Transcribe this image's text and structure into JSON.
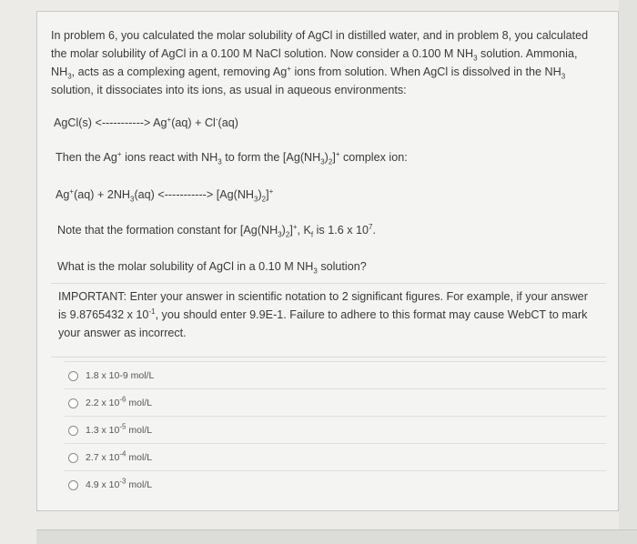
{
  "intro": [
    {
      "t": "In problem 6, you calculated the molar solubility of AgCl in distilled water, and in problem 8, you calculated the molar solubility of AgCl in a 0.100 M NaCl solution.  Now consider a 0.100 M NH"
    },
    {
      "t": "3",
      "k": "sub"
    },
    {
      "t": " solution. Ammonia, NH"
    },
    {
      "t": "3",
      "k": "sub"
    },
    {
      "t": ", acts as a complexing agent, removing Ag"
    },
    {
      "t": "+",
      "k": "sup"
    },
    {
      "t": " ions from solution. When AgCl is dissolved in the NH"
    },
    {
      "t": "3",
      "k": "sub"
    },
    {
      "t": " solution, it dissociates into its ions, as usual in aqueous environments:"
    }
  ],
  "eq1": [
    {
      "t": "AgCl(s)  <----------->  Ag"
    },
    {
      "t": "+",
      "k": "sup"
    },
    {
      "t": "(aq)  +  Cl"
    },
    {
      "t": "-",
      "k": "sup"
    },
    {
      "t": "(aq)"
    }
  ],
  "then": [
    {
      "t": "Then the Ag"
    },
    {
      "t": "+",
      "k": "sup"
    },
    {
      "t": " ions react with NH"
    },
    {
      "t": "3",
      "k": "sub"
    },
    {
      "t": " to form the [Ag(NH"
    },
    {
      "t": "3",
      "k": "sub"
    },
    {
      "t": ")"
    },
    {
      "t": "2",
      "k": "sub"
    },
    {
      "t": "]"
    },
    {
      "t": "+",
      "k": "sup"
    },
    {
      "t": " complex ion:"
    }
  ],
  "eq2": [
    {
      "t": "Ag"
    },
    {
      "t": "+",
      "k": "sup"
    },
    {
      "t": "(aq)  +  2NH"
    },
    {
      "t": "3",
      "k": "sub"
    },
    {
      "t": "(aq)  <----------->  [Ag(NH"
    },
    {
      "t": "3",
      "k": "sub"
    },
    {
      "t": ")"
    },
    {
      "t": "2",
      "k": "sub"
    },
    {
      "t": "]"
    },
    {
      "t": "+",
      "k": "sup"
    }
  ],
  "note": [
    {
      "t": "Note that the formation constant for [Ag(NH"
    },
    {
      "t": "3",
      "k": "sub"
    },
    {
      "t": ")"
    },
    {
      "t": "2",
      "k": "sub"
    },
    {
      "t": "]"
    },
    {
      "t": "+",
      "k": "sup"
    },
    {
      "t": ", K"
    },
    {
      "t": "f",
      "k": "sub"
    },
    {
      "t": " is 1.6 x 10"
    },
    {
      "t": "7",
      "k": "sup"
    },
    {
      "t": "."
    }
  ],
  "question": [
    {
      "t": "What is the molar solubility of AgCl in a 0.10 M NH"
    },
    {
      "t": "3",
      "k": "sub"
    },
    {
      "t": " solution?"
    }
  ],
  "important": [
    {
      "t": "IMPORTANT: Enter your answer in scientific notation to 2 significant figures.  For example, if your answer is 9.8765432 x 10"
    },
    {
      "t": "-1",
      "k": "sup"
    },
    {
      "t": ", you should enter 9.9E-1.  Failure to adhere to this format may cause WebCT to mark your answer as incorrect."
    }
  ],
  "options": [
    [
      {
        "t": "1.8 x 10-9 mol/L"
      }
    ],
    [
      {
        "t": "2.2 x 10"
      },
      {
        "t": "-6",
        "k": "sup"
      },
      {
        "t": " mol/L"
      }
    ],
    [
      {
        "t": "1.3 x 10"
      },
      {
        "t": "-5",
        "k": "sup"
      },
      {
        "t": " mol/L"
      }
    ],
    [
      {
        "t": "2.7 x 10"
      },
      {
        "t": "-4",
        "k": "sup"
      },
      {
        "t": " mol/L"
      }
    ],
    [
      {
        "t": "4.9 x 10"
      },
      {
        "t": "-3",
        "k": "sup"
      },
      {
        "t": " mol/L"
      }
    ]
  ]
}
